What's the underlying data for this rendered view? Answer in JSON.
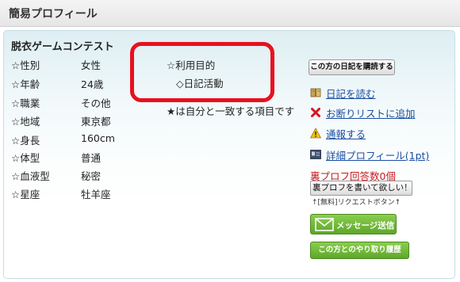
{
  "header": {
    "title": "簡易プロフィール"
  },
  "profile": {
    "name": "脱衣ゲームコンテスト",
    "rows": [
      {
        "label": "☆性別",
        "value": "女性"
      },
      {
        "label": "☆年齢",
        "value": "24歳"
      },
      {
        "label": "☆職業",
        "value": "その他"
      },
      {
        "label": "☆地域",
        "value": "東京都"
      },
      {
        "label": "☆身長",
        "value": "160cm"
      },
      {
        "label": "☆体型",
        "value": "普通"
      },
      {
        "label": "☆血液型",
        "value": "秘密"
      },
      {
        "label": "☆星座",
        "value": "牡羊座"
      }
    ]
  },
  "purpose": {
    "label": "☆利用目的",
    "item": "◇日記活動",
    "match_note": "★は自分と一致する項目です"
  },
  "actions": {
    "subscribe_diary_button": "この方の日記を購読する",
    "links": [
      {
        "icon": "book-icon",
        "label": "日記を読む"
      },
      {
        "icon": "red-x-icon",
        "label": "お断りリストに追加"
      },
      {
        "icon": "warning-icon",
        "label": "通報する"
      },
      {
        "icon": "profile-card-icon",
        "label": "詳細プロフィール(1pt)"
      }
    ],
    "ura_count": "裏プロフ回答数0個",
    "ura_request_button": "裏プロフを書いて欲しい！",
    "request_note": "↑[無料]リクエストボタン↑",
    "send_message_button": "メッセージ送信",
    "history_button": "この方とのやり取り履歴"
  },
  "colors": {
    "highlight_border": "#e8101f",
    "link": "#1a4fa0",
    "ura_text": "#c8181e",
    "green_button": "#6bb334"
  }
}
